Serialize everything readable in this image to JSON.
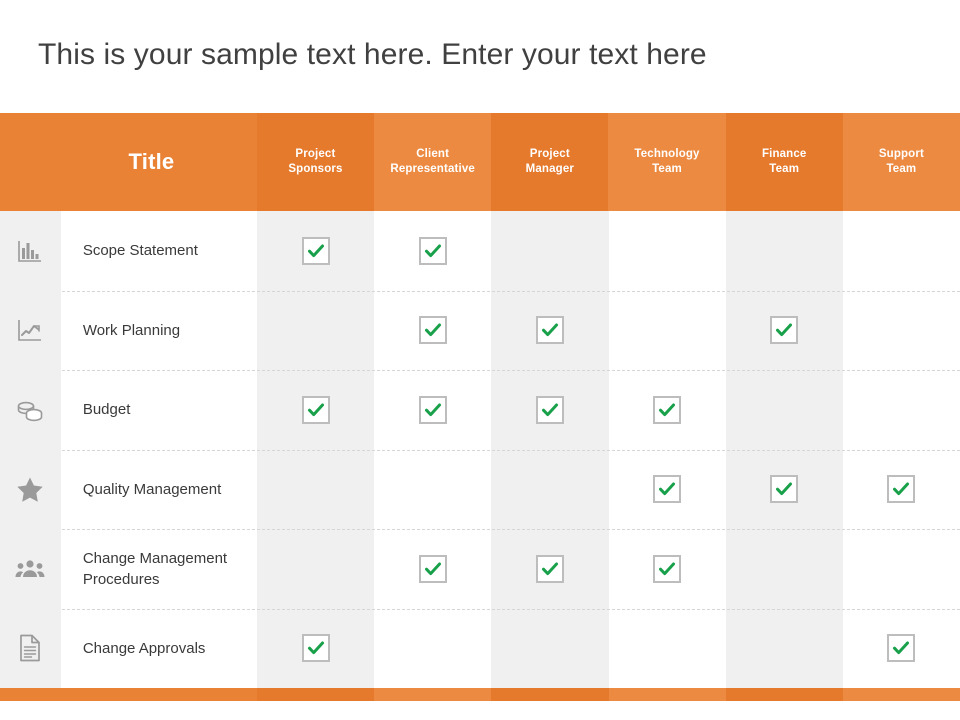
{
  "slide": {
    "title": "This is your sample text here. Enter your text here",
    "accent_orange": "#ea8236",
    "accent_orange_dark": "#e5792c",
    "accent_orange_light": "#ec8a41",
    "check_green": "#19a04a",
    "stripe_gray": "#f0f0f0"
  },
  "table": {
    "corner_header": "Title",
    "columns": [
      {
        "label_line1": "Project",
        "label_line2": "Sponsors",
        "shade": "dark"
      },
      {
        "label_line1": "Client",
        "label_line2": "Representative",
        "shade": "light"
      },
      {
        "label_line1": "Project",
        "label_line2": "Manager",
        "shade": "dark"
      },
      {
        "label_line1": "Technology",
        "label_line2": "Team",
        "shade": "light"
      },
      {
        "label_line1": "Finance",
        "label_line2": "Team",
        "shade": "dark"
      },
      {
        "label_line1": "Support",
        "label_line2": "Team",
        "shade": "light"
      }
    ],
    "rows": [
      {
        "icon": "bar-chart-icon",
        "label": "Scope Statement",
        "checks": [
          true,
          true,
          false,
          false,
          false,
          false
        ]
      },
      {
        "icon": "line-chart-icon",
        "label": "Work Planning",
        "checks": [
          false,
          true,
          true,
          false,
          true,
          false
        ]
      },
      {
        "icon": "coins-icon",
        "label": "Budget",
        "checks": [
          true,
          true,
          true,
          true,
          false,
          false
        ]
      },
      {
        "icon": "star-icon",
        "label": "Quality Management",
        "checks": [
          false,
          false,
          false,
          true,
          true,
          true
        ]
      },
      {
        "icon": "people-icon",
        "label": "Change Management Procedures",
        "checks": [
          false,
          true,
          true,
          true,
          false,
          false
        ]
      },
      {
        "icon": "document-icon",
        "label": "Change Approvals",
        "checks": [
          true,
          false,
          false,
          false,
          false,
          true
        ]
      }
    ]
  }
}
